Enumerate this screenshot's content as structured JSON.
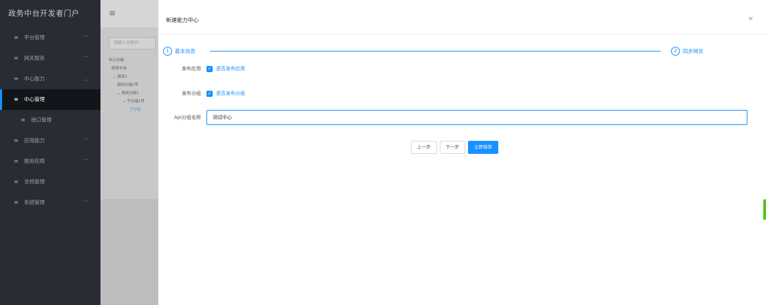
{
  "sidebar": {
    "brand": "政务中台开发者门户",
    "items": [
      {
        "label": "平台管理",
        "chev": "﹀"
      },
      {
        "label": "网关服务",
        "chev": "﹀"
      },
      {
        "label": "中心能力",
        "chev": "︿"
      },
      {
        "label": "中心管理",
        "chev": ""
      },
      {
        "label": "接口管理",
        "chev": ""
      },
      {
        "label": "应用能力",
        "chev": "﹀"
      },
      {
        "label": "服务权限",
        "chev": "﹀"
      },
      {
        "label": "文档管理",
        "chev": ""
      },
      {
        "label": "系统管理",
        "chev": "﹀"
      }
    ]
  },
  "background": {
    "search_placeholder": "请输入关键词",
    "tree": [
      "中心分组",
      "政务中台",
      "测试1",
      "测试分组1号",
      "测试分组1",
      "子分组1号",
      "子分组"
    ]
  },
  "drawer": {
    "title": "新建能力中心",
    "close": "×",
    "steps": [
      {
        "num": "1",
        "label": "基本信息"
      },
      {
        "num": "2",
        "label": "同步网关"
      }
    ],
    "form": {
      "publish_app_label": "发布应用",
      "publish_app_check": "是否发布应用",
      "publish_group_label": "发布分组",
      "publish_group_check": "是否发布分组",
      "api_group_label": "Api分组名称",
      "api_group_value": "测试中心"
    },
    "buttons": {
      "prev": "上一步",
      "next": "下一步",
      "save": "立即保存"
    }
  },
  "colors": {
    "accent": "#1890ff",
    "sidebar_bg": "#282c34"
  }
}
